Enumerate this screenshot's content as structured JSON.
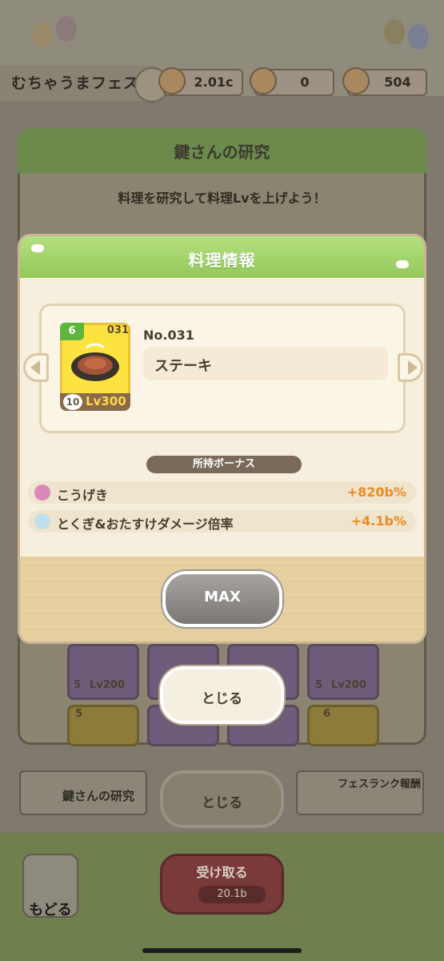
{
  "header": {
    "fest_title": "むちゃうまフェス",
    "currencies": [
      {
        "icon": "chef-coin-icon",
        "value": "2.01c"
      },
      {
        "icon": "chef-candy-icon",
        "value": "0"
      },
      {
        "icon": "lollipop-icon",
        "value": "504"
      }
    ]
  },
  "research_panel": {
    "title": "鍵さんの研究",
    "subtitle": "料理を研究して料理Lvを上げよう！",
    "card_levels": [
      "Lv200",
      "Lv200"
    ],
    "card_level_badges": [
      "5",
      "5"
    ],
    "lower_card_stars": [
      "5",
      "6"
    ]
  },
  "dialog": {
    "title": "料理情報",
    "food": {
      "stars": "6",
      "number_small": "031",
      "count": "10",
      "level": "Lv300",
      "number_label": "No.031",
      "name": "ステーキ"
    },
    "bonus_title": "所持ボーナス",
    "bonuses": [
      {
        "icon": "attack-icon",
        "label": "こうげき",
        "value": "+820b%"
      },
      {
        "icon": "special-damage-icon",
        "label": "とくぎ&おたすけダメージ倍率",
        "value": "+4.1b%"
      }
    ],
    "max_button": "MAX"
  },
  "close_button": "とじる",
  "bottom_nav": {
    "tab_research": "鍵さんの研究",
    "close_bg": "とじる",
    "tab_rank": "フェスランク報酬",
    "back": "もどる",
    "receive": "受け取る",
    "receive_cost": "20.1b"
  },
  "colors": {
    "accent_green": "#9fd165",
    "value_orange": "#f08a1f",
    "card_yellow": "#fde33f"
  }
}
